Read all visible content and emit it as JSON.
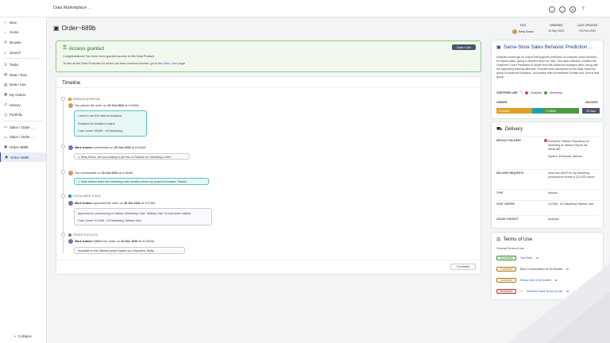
{
  "header": {
    "app_title": "Data Marketplace"
  },
  "sidebar": {
    "items": [
      {
        "icon": "plus-icon",
        "label": "New"
      },
      {
        "icon": "home-icon",
        "label": "Home"
      },
      {
        "icon": "compass-icon",
        "label": "Browse"
      },
      {
        "icon": "search-icon",
        "label": "Search"
      },
      {
        "icon": "tasks-icon",
        "label": "Tasks"
      },
      {
        "icon": "data-icon",
        "label": "Data I Own"
      },
      {
        "icon": "data-icon",
        "label": "Data I Use"
      },
      {
        "icon": "orders-icon",
        "label": "My Orders"
      },
      {
        "icon": "history-icon",
        "label": "History"
      },
      {
        "icon": "portfolio-icon",
        "label": "Portfolio"
      },
      {
        "icon": "tab-icon",
        "label": "Sales / Order ..."
      },
      {
        "icon": "tab-icon",
        "label": "Sales / Order ..."
      },
      {
        "icon": "order-icon",
        "label": "Order~689b"
      },
      {
        "icon": "order-icon",
        "label": "Order~689b"
      }
    ],
    "collapse": "Collapse"
  },
  "page": {
    "title": "Order~689b",
    "meta": [
      {
        "label": "FOR",
        "value": "Betty Braun"
      },
      {
        "label": "ORDERED",
        "value": "14 Sep 2022"
      },
      {
        "label": "LAST UPDATED",
        "value": "03 Feb 2023"
      }
    ]
  },
  "access": {
    "title": "Access granted",
    "line1": "Congratulations! You have been granted access to this Data Product.",
    "line2_pre": "To see all the Data Products for which you have received access, go to the ",
    "line2_link": "Data I Use",
    "line2_post": " page.",
    "button": "Data I Use"
  },
  "timeline": {
    "title": "Timeline",
    "pending": "PENDING APPROVAL",
    "e1": {
      "pre": "You placed the order on ",
      "date": "20 Oct 2022",
      "post": " at 9:42AM",
      "lines": [
        "I want to use this data for Analytics",
        "Required for analytics project",
        "Cost Center: 90408 - US Marketing"
      ]
    },
    "e2": {
      "who": "Mark Adams",
      "mid": " commented on ",
      "date": "20 Oct 2022",
      "post": " at 9:42AM",
      "text": "Betty Braun, are you looking to get this on Tableau for Marketing Cube?"
    },
    "e3": {
      "pre": "You commented on ",
      "date": "20 Oct 2022",
      "post": " at 9:44AM",
      "text": "Mark Adams that's the marketing cube location where my project is located. Thanks"
    },
    "fulfill": "FULFILLMENT STAGE",
    "e4": {
      "who": "Mark Adams",
      "mid": " approved the order on ",
      "date": "20 Oct 2022",
      "post": " at 9:47AM",
      "lines": [
        "Approved for provisioning to Tableau Marketing Cube, Tableau User Groups team notified.",
        "Cost Center: 012398 - US Marketing Tableau User"
      ]
    },
    "done": "ORDER FULFILLED",
    "e5": {
      "who": "Mark Adams",
      "mid": " fulfilled the order on ",
      "date": "16 Dec 2022",
      "post": " at 11:00AM",
      "text": "Available on the Tableau project space you requested, Betty."
    },
    "comment_btn": "Comment"
  },
  "product": {
    "title": "Same-Store Sales Behavior Prediction ...",
    "desc": "Analytics teams get an output that supports prediction of customer churn behavior for repeat sales, giving a retention lever for view. This data collection contains the Customer Churn Prediction AI Model from the Advanced Analytics team, along with the supporting training data sets. Provided and maintained by the Data Sciences group in Advanced Analytics, and please refer all feedback to Mark and John in that group.",
    "cert_label": "CERTIFIED USE",
    "cert": [
      "Analytics",
      "Marketing"
    ],
    "orders_label": "ORDERS",
    "delivery_label": "DELIVERY",
    "orders": [
      {
        "label": "3 Ordered",
        "value": 3
      },
      {
        "label": "",
        "value": 1
      },
      {
        "label": "2 Fulfilled",
        "value": 3
      }
    ],
    "delivery_btn": "30 Days"
  },
  "delivery": {
    "title": "Delivery",
    "rows": [
      {
        "k": "DEFAULT DELIVERY",
        "v": "Enterprise Tableau Repository for Marketing at Tableau Report via WEBLINK",
        "v2": "System: Enterprise Tableau"
      },
      {
        "k": "DELIVERY REQUESTS",
        "v": "Need this ASAP for my Marketing performance trends in Q3 2022 report"
      },
      {
        "k": "TYPE",
        "v": "Manual"
      },
      {
        "k": "COST CENTER",
        "v": "012398 - US Marketing Tableau User"
      },
      {
        "k": "USAGE CONTEXT",
        "v": "Analytics"
      }
    ]
  },
  "tou": {
    "title": "Terms of Use",
    "sub": "General Terms of Use",
    "items": [
      {
        "pill": "Accessible",
        "text": "Test Data",
        "color": "#3a8a3a",
        "bg": "#eef8ea"
      },
      {
        "pill": "Controlled",
        "text": "Bias Compensation for AI Models",
        "color": "#b07b1e",
        "bg": "#fbf3e2"
      },
      {
        "pill": "Controlled",
        "text": "Ethical Use of AI Models",
        "color": "#b07b1e",
        "bg": "#fbf3e2"
      },
      {
        "pill": "Restricted",
        "text": "Sensitive Data Terms of Use",
        "color": "#b33a3a",
        "bg": "#fbeaea"
      }
    ]
  },
  "colors": {
    "brand": "#1f3c88",
    "success": "#4c9a3f",
    "teal": "#1fa0a8",
    "orange": "#e0a020",
    "slate": "#4a5568"
  }
}
